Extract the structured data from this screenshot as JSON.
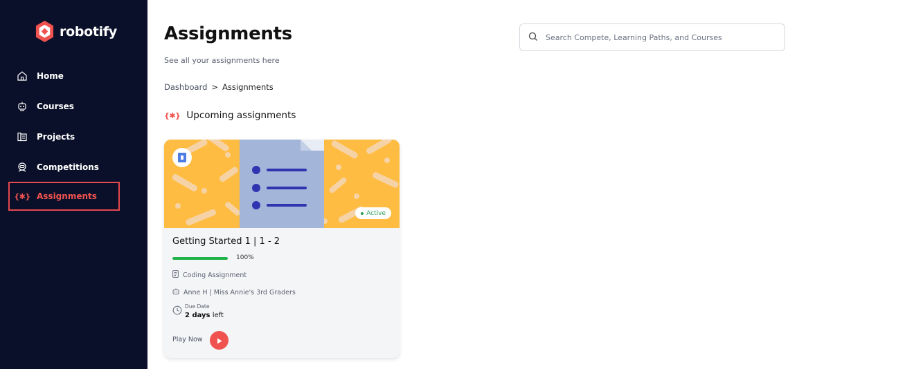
{
  "brand": {
    "name": "robotify",
    "accent": "#f0534f"
  },
  "sidebar": {
    "items": [
      {
        "label": "Home",
        "icon": "home-icon",
        "active": false
      },
      {
        "label": "Courses",
        "icon": "robot-head-icon",
        "active": false
      },
      {
        "label": "Projects",
        "icon": "blueprint-icon",
        "active": false
      },
      {
        "label": "Competitions",
        "icon": "astronaut-icon",
        "active": false
      },
      {
        "label": "Assignments",
        "icon": "assignment-icon",
        "active": true
      }
    ]
  },
  "header": {
    "title": "Assignments",
    "subtitle": "See all your assignments here"
  },
  "breadcrumb": {
    "parent": "Dashboard",
    "separator": ">",
    "current": "Assignments"
  },
  "search": {
    "placeholder": "Search Compete, Learning Paths, and Courses"
  },
  "section": {
    "title": "Upcoming assignments",
    "glyph": "{✱}"
  },
  "cards": [
    {
      "title": "Getting Started 1 | 1 - 2",
      "status": "Active",
      "progress": 1.0,
      "progress_label": "100%",
      "type": "Coding Assignment",
      "teacher": "Anne H | Miss Annie's 3rd Graders",
      "due_label": "Due Date",
      "due_value_bold": "2 days",
      "due_value_rest": " left",
      "play_label": "Play Now",
      "hero_color": "#ffbc42",
      "doc_color": "#a3b5d8",
      "list_color": "#2f35b0"
    }
  ]
}
